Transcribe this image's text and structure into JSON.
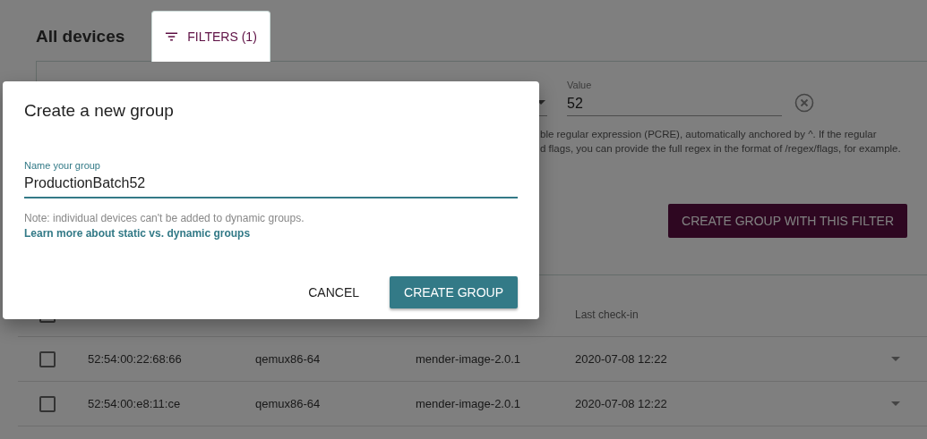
{
  "page": {
    "title": "All devices",
    "tabs": [
      {
        "label": "FILTERS (1)",
        "selected": true
      }
    ]
  },
  "filter": {
    "value_label": "Value",
    "value": "52",
    "help_lines": [
      "ble regular expression (PCRE), automatically anchored by ^. If the regular",
      "d flags, you can provide the full regex in the format of /regex/flags, for example."
    ],
    "create_button": "CREATE GROUP WITH THIS FILTER"
  },
  "table": {
    "select_all_checked": false,
    "columns": [
      {},
      {},
      {},
      {
        "label": "Last check-in"
      }
    ],
    "rows": [
      {
        "checked": false,
        "cells": [
          "52:54:00:22:68:66",
          "qemux86-64",
          "mender-image-2.0.1",
          "2020-07-08 12:22"
        ]
      },
      {
        "checked": false,
        "cells": [
          "52:54:00:e8:11:ce",
          "qemux86-64",
          "mender-image-2.0.1",
          "2020-07-08 12:22"
        ]
      }
    ]
  },
  "dialog": {
    "title": "Create a new group",
    "field_label": "Name your group",
    "field_value": "ProductionBatch52",
    "note": "Note: individual devices can't be added to dynamic groups.",
    "note_link": "Learn more about static vs. dynamic groups",
    "buttons": [
      {
        "label": "CANCEL",
        "kind": "text"
      },
      {
        "label": "CREATE GROUP",
        "kind": "primary"
      }
    ]
  }
}
